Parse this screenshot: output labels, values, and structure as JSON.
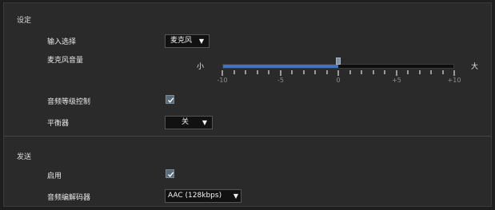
{
  "sections": {
    "settings_title": "设定",
    "send_title": "发送"
  },
  "settings": {
    "input_select": {
      "label": "输入选择",
      "value": "麦克风"
    },
    "mic_volume": {
      "label": "麦克风音量",
      "min_label": "小",
      "max_label": "大",
      "value": 0,
      "range": [
        -10,
        10
      ],
      "tick_labels": [
        "-10",
        "-5",
        "0",
        "+5",
        "+10"
      ]
    },
    "audio_level_control": {
      "label": "音频等级控制",
      "checked": true
    },
    "equalizer": {
      "label": "平衡器",
      "value": "关"
    }
  },
  "send": {
    "enable": {
      "label": "启用",
      "checked": true
    },
    "codec": {
      "label": "音频编解码器",
      "value": "AAC (128kbps)"
    }
  },
  "icons": {
    "dropdown": "triangle-down-icon",
    "check": "checkmark-icon"
  },
  "colors": {
    "accent": "#3f73c8",
    "checkbox": "#596a78",
    "background": "#2a2a2a"
  }
}
